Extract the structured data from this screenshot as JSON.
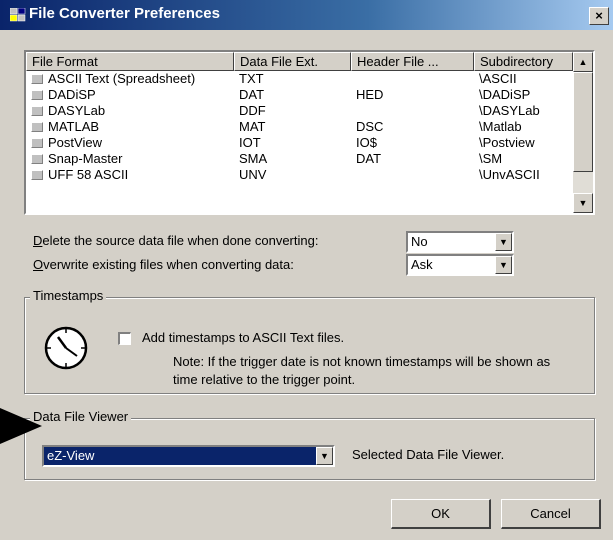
{
  "window": {
    "title": "File Converter Preferences",
    "close_glyph": "×"
  },
  "formats_table": {
    "columns": [
      "File Format",
      "Data File Ext.",
      "Header File ...",
      "Subdirectory"
    ],
    "rows": [
      {
        "format": "ASCII Text (Spreadsheet)",
        "data_ext": "TXT",
        "header_ext": "",
        "subdir": "\\ASCII"
      },
      {
        "format": "DADiSP",
        "data_ext": "DAT",
        "header_ext": "HED",
        "subdir": "\\DADiSP"
      },
      {
        "format": "DASYLab",
        "data_ext": "DDF",
        "header_ext": "",
        "subdir": "\\DASYLab"
      },
      {
        "format": "MATLAB",
        "data_ext": "MAT",
        "header_ext": "DSC",
        "subdir": "\\Matlab"
      },
      {
        "format": "PostView",
        "data_ext": "IOT",
        "header_ext": "IO$",
        "subdir": "\\Postview"
      },
      {
        "format": "Snap-Master",
        "data_ext": "SMA",
        "header_ext": "DAT",
        "subdir": "\\SM"
      },
      {
        "format": "UFF 58 ASCII",
        "data_ext": "UNV",
        "header_ext": "",
        "subdir": "\\UnvASCII"
      }
    ]
  },
  "options": {
    "delete_label_key": "D",
    "delete_label_rest": "elete the source data file when done converting:",
    "delete_value": "No",
    "overwrite_label_key": "O",
    "overwrite_label_rest": "verwrite existing files when converting data:",
    "overwrite_value": "Ask"
  },
  "timestamps": {
    "group_title": "Timestamps",
    "checkbox_label": "Add timestamps to ASCII Text files.",
    "note_line1": "Note: If the trigger date is not known timestamps will be shown as",
    "note_line2": "time relative to the trigger point.",
    "icon": "clock-icon"
  },
  "viewer": {
    "group_title": "Data File Viewer",
    "selected": "eZ-View",
    "caption": "Selected Data File Viewer."
  },
  "buttons": {
    "ok": "OK",
    "cancel": "Cancel"
  },
  "colors": {
    "title_bar": "#0a246a",
    "selection": "#0a246a",
    "face": "#d4d0c8"
  }
}
